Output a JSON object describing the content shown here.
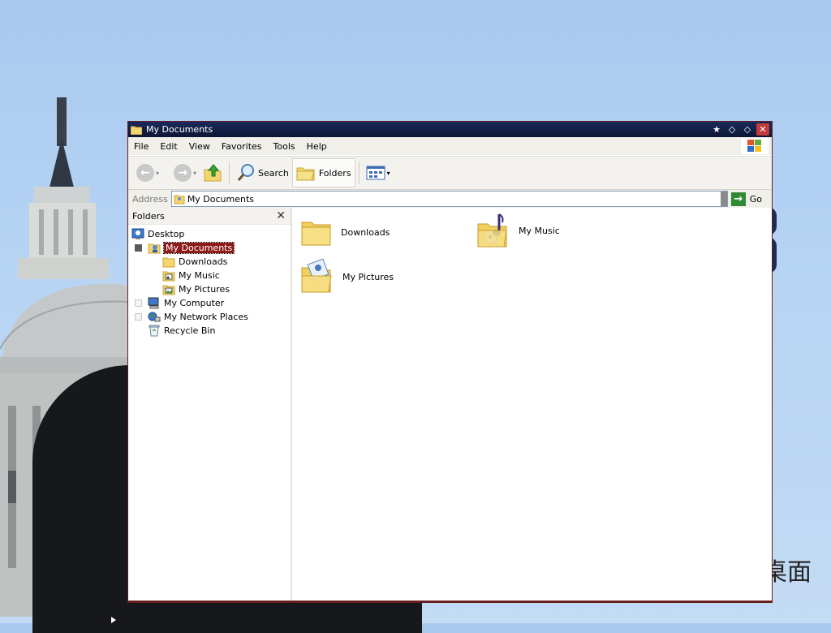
{
  "window": {
    "title": "My Documents",
    "accent_color": "#8e1a1a",
    "titlebar_color": "#1a2a5c"
  },
  "menu": {
    "items": [
      "File",
      "Edit",
      "View",
      "Favorites",
      "Tools",
      "Help"
    ]
  },
  "toolbar": {
    "search_label": "Search",
    "folders_label": "Folders"
  },
  "address": {
    "label": "Address",
    "value": "My Documents",
    "go_label": "Go"
  },
  "folders_pane": {
    "title": "Folders",
    "tree": [
      {
        "label": "Desktop",
        "icon": "desktop-icon"
      },
      {
        "label": "My Documents",
        "icon": "my-documents-icon",
        "selected": true
      },
      {
        "label": "Downloads",
        "icon": "folder-icon"
      },
      {
        "label": "My Music",
        "icon": "music-folder-icon"
      },
      {
        "label": "My Pictures",
        "icon": "pictures-folder-icon"
      },
      {
        "label": "My Computer",
        "icon": "computer-icon"
      },
      {
        "label": "My Network Places",
        "icon": "network-icon"
      },
      {
        "label": "Recycle Bin",
        "icon": "recycle-bin-icon"
      }
    ]
  },
  "content": {
    "items": [
      {
        "label": "Downloads",
        "icon": "folder-icon"
      },
      {
        "label": "My Music",
        "icon": "music-folder-icon"
      },
      {
        "label": "My Pictures",
        "icon": "pictures-folder-icon"
      }
    ]
  },
  "desktop": {
    "watermark": "桌面"
  }
}
